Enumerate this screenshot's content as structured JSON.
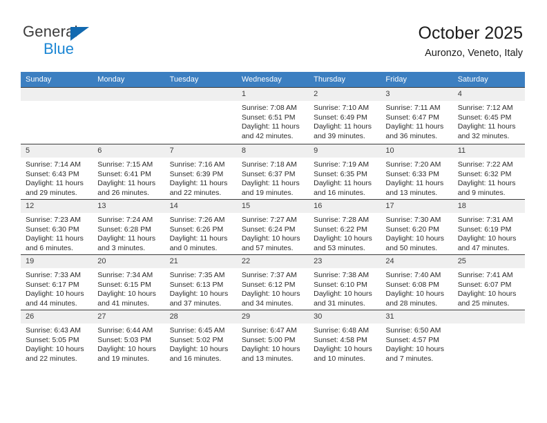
{
  "brand": {
    "name_part1": "General",
    "name_part2": "Blue",
    "triangle_color": "#1269b0",
    "blue_text_color": "#1b86d4"
  },
  "header": {
    "title": "October 2025",
    "subtitle": "Auronzo, Veneto, Italy"
  },
  "theme": {
    "header_row_bg": "#3c7fc1",
    "header_row_text": "#ffffff",
    "daynum_bg": "#efefef",
    "grid_line": "#3a3a3a",
    "body_text": "#2b2b2b"
  },
  "weekdays": [
    "Sunday",
    "Monday",
    "Tuesday",
    "Wednesday",
    "Thursday",
    "Friday",
    "Saturday"
  ],
  "labels": {
    "sunrise_prefix": "Sunrise:",
    "sunset_prefix": "Sunset:",
    "daylight_prefix": "Daylight:"
  },
  "weeks": [
    [
      {
        "day": "",
        "blank": true
      },
      {
        "day": "",
        "blank": true
      },
      {
        "day": "",
        "blank": true
      },
      {
        "day": "1",
        "l1": "Sunrise: 7:08 AM",
        "l2": "Sunset: 6:51 PM",
        "l3": "Daylight: 11 hours",
        "l4": "and 42 minutes."
      },
      {
        "day": "2",
        "l1": "Sunrise: 7:10 AM",
        "l2": "Sunset: 6:49 PM",
        "l3": "Daylight: 11 hours",
        "l4": "and 39 minutes."
      },
      {
        "day": "3",
        "l1": "Sunrise: 7:11 AM",
        "l2": "Sunset: 6:47 PM",
        "l3": "Daylight: 11 hours",
        "l4": "and 36 minutes."
      },
      {
        "day": "4",
        "l1": "Sunrise: 7:12 AM",
        "l2": "Sunset: 6:45 PM",
        "l3": "Daylight: 11 hours",
        "l4": "and 32 minutes."
      }
    ],
    [
      {
        "day": "5",
        "l1": "Sunrise: 7:14 AM",
        "l2": "Sunset: 6:43 PM",
        "l3": "Daylight: 11 hours",
        "l4": "and 29 minutes."
      },
      {
        "day": "6",
        "l1": "Sunrise: 7:15 AM",
        "l2": "Sunset: 6:41 PM",
        "l3": "Daylight: 11 hours",
        "l4": "and 26 minutes."
      },
      {
        "day": "7",
        "l1": "Sunrise: 7:16 AM",
        "l2": "Sunset: 6:39 PM",
        "l3": "Daylight: 11 hours",
        "l4": "and 22 minutes."
      },
      {
        "day": "8",
        "l1": "Sunrise: 7:18 AM",
        "l2": "Sunset: 6:37 PM",
        "l3": "Daylight: 11 hours",
        "l4": "and 19 minutes."
      },
      {
        "day": "9",
        "l1": "Sunrise: 7:19 AM",
        "l2": "Sunset: 6:35 PM",
        "l3": "Daylight: 11 hours",
        "l4": "and 16 minutes."
      },
      {
        "day": "10",
        "l1": "Sunrise: 7:20 AM",
        "l2": "Sunset: 6:33 PM",
        "l3": "Daylight: 11 hours",
        "l4": "and 13 minutes."
      },
      {
        "day": "11",
        "l1": "Sunrise: 7:22 AM",
        "l2": "Sunset: 6:32 PM",
        "l3": "Daylight: 11 hours",
        "l4": "and 9 minutes."
      }
    ],
    [
      {
        "day": "12",
        "l1": "Sunrise: 7:23 AM",
        "l2": "Sunset: 6:30 PM",
        "l3": "Daylight: 11 hours",
        "l4": "and 6 minutes."
      },
      {
        "day": "13",
        "l1": "Sunrise: 7:24 AM",
        "l2": "Sunset: 6:28 PM",
        "l3": "Daylight: 11 hours",
        "l4": "and 3 minutes."
      },
      {
        "day": "14",
        "l1": "Sunrise: 7:26 AM",
        "l2": "Sunset: 6:26 PM",
        "l3": "Daylight: 11 hours",
        "l4": "and 0 minutes."
      },
      {
        "day": "15",
        "l1": "Sunrise: 7:27 AM",
        "l2": "Sunset: 6:24 PM",
        "l3": "Daylight: 10 hours",
        "l4": "and 57 minutes."
      },
      {
        "day": "16",
        "l1": "Sunrise: 7:28 AM",
        "l2": "Sunset: 6:22 PM",
        "l3": "Daylight: 10 hours",
        "l4": "and 53 minutes."
      },
      {
        "day": "17",
        "l1": "Sunrise: 7:30 AM",
        "l2": "Sunset: 6:20 PM",
        "l3": "Daylight: 10 hours",
        "l4": "and 50 minutes."
      },
      {
        "day": "18",
        "l1": "Sunrise: 7:31 AM",
        "l2": "Sunset: 6:19 PM",
        "l3": "Daylight: 10 hours",
        "l4": "and 47 minutes."
      }
    ],
    [
      {
        "day": "19",
        "l1": "Sunrise: 7:33 AM",
        "l2": "Sunset: 6:17 PM",
        "l3": "Daylight: 10 hours",
        "l4": "and 44 minutes."
      },
      {
        "day": "20",
        "l1": "Sunrise: 7:34 AM",
        "l2": "Sunset: 6:15 PM",
        "l3": "Daylight: 10 hours",
        "l4": "and 41 minutes."
      },
      {
        "day": "21",
        "l1": "Sunrise: 7:35 AM",
        "l2": "Sunset: 6:13 PM",
        "l3": "Daylight: 10 hours",
        "l4": "and 37 minutes."
      },
      {
        "day": "22",
        "l1": "Sunrise: 7:37 AM",
        "l2": "Sunset: 6:12 PM",
        "l3": "Daylight: 10 hours",
        "l4": "and 34 minutes."
      },
      {
        "day": "23",
        "l1": "Sunrise: 7:38 AM",
        "l2": "Sunset: 6:10 PM",
        "l3": "Daylight: 10 hours",
        "l4": "and 31 minutes."
      },
      {
        "day": "24",
        "l1": "Sunrise: 7:40 AM",
        "l2": "Sunset: 6:08 PM",
        "l3": "Daylight: 10 hours",
        "l4": "and 28 minutes."
      },
      {
        "day": "25",
        "l1": "Sunrise: 7:41 AM",
        "l2": "Sunset: 6:07 PM",
        "l3": "Daylight: 10 hours",
        "l4": "and 25 minutes."
      }
    ],
    [
      {
        "day": "26",
        "l1": "Sunrise: 6:43 AM",
        "l2": "Sunset: 5:05 PM",
        "l3": "Daylight: 10 hours",
        "l4": "and 22 minutes."
      },
      {
        "day": "27",
        "l1": "Sunrise: 6:44 AM",
        "l2": "Sunset: 5:03 PM",
        "l3": "Daylight: 10 hours",
        "l4": "and 19 minutes."
      },
      {
        "day": "28",
        "l1": "Sunrise: 6:45 AM",
        "l2": "Sunset: 5:02 PM",
        "l3": "Daylight: 10 hours",
        "l4": "and 16 minutes."
      },
      {
        "day": "29",
        "l1": "Sunrise: 6:47 AM",
        "l2": "Sunset: 5:00 PM",
        "l3": "Daylight: 10 hours",
        "l4": "and 13 minutes."
      },
      {
        "day": "30",
        "l1": "Sunrise: 6:48 AM",
        "l2": "Sunset: 4:58 PM",
        "l3": "Daylight: 10 hours",
        "l4": "and 10 minutes."
      },
      {
        "day": "31",
        "l1": "Sunrise: 6:50 AM",
        "l2": "Sunset: 4:57 PM",
        "l3": "Daylight: 10 hours",
        "l4": "and 7 minutes."
      },
      {
        "day": "",
        "blank": true
      }
    ]
  ]
}
